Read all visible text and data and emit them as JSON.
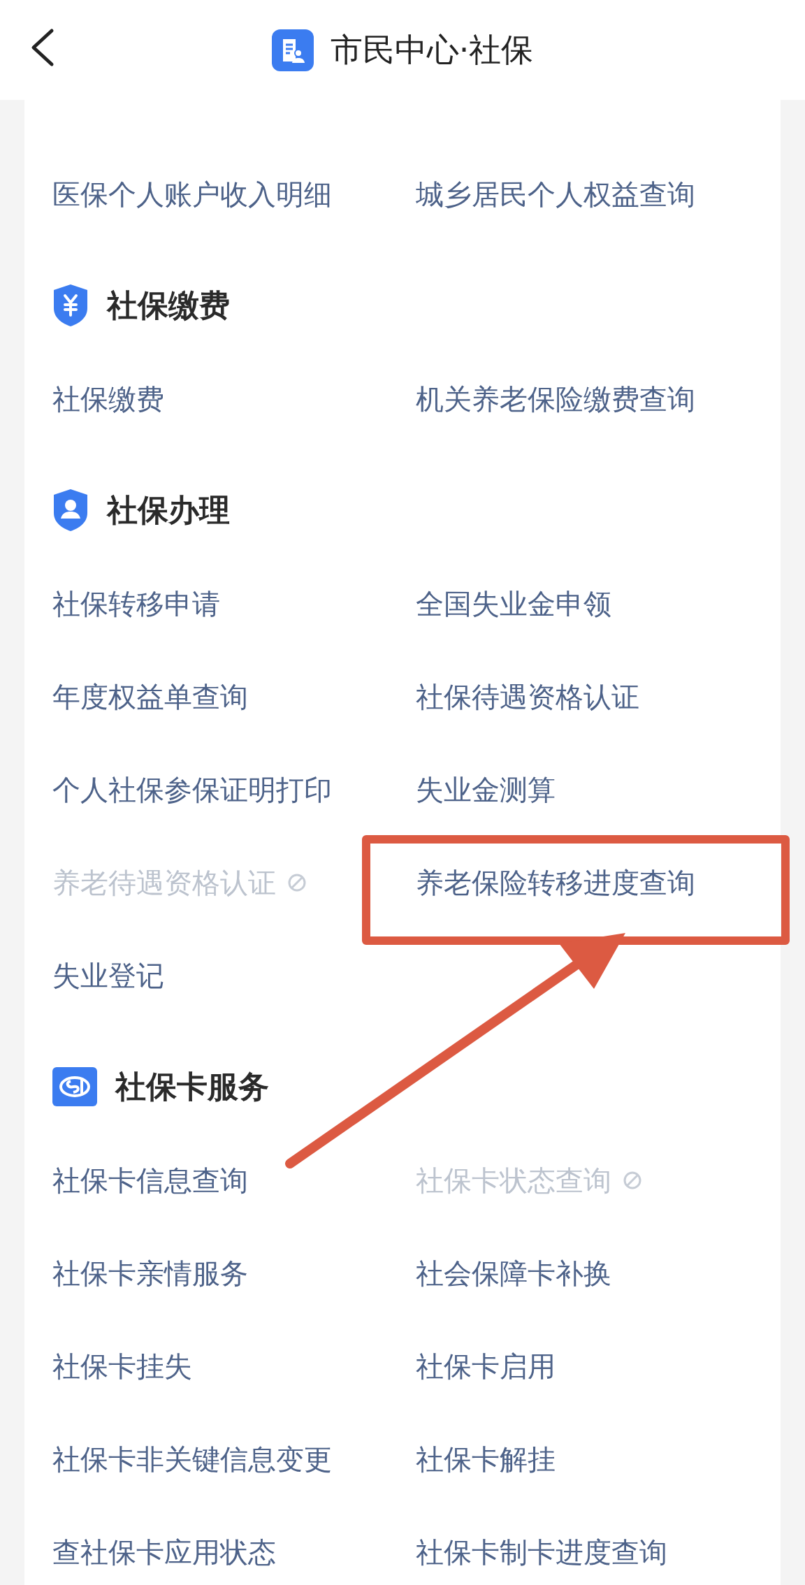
{
  "header": {
    "title": "市民中心·社保"
  },
  "sections": [
    {
      "items": [
        {
          "label": "医保个人账户收入明细",
          "disabled": false
        },
        {
          "label": "城乡居民个人权益查询",
          "disabled": false
        }
      ]
    },
    {
      "title": "社保缴费",
      "kind": "yuan-shield",
      "items": [
        {
          "label": "社保缴费",
          "disabled": false
        },
        {
          "label": "机关养老保险缴费查询",
          "disabled": false
        }
      ]
    },
    {
      "title": "社保办理",
      "kind": "person-shield",
      "items": [
        {
          "label": "社保转移申请",
          "disabled": false
        },
        {
          "label": "全国失业金申领",
          "disabled": false
        },
        {
          "label": "年度权益单查询",
          "disabled": false
        },
        {
          "label": "社保待遇资格认证",
          "disabled": false
        },
        {
          "label": "个人社保参保证明打印",
          "disabled": false
        },
        {
          "label": "失业金测算",
          "disabled": false
        },
        {
          "label": "养老待遇资格认证",
          "disabled": true
        },
        {
          "label": "养老保险转移进度查询",
          "disabled": false
        },
        {
          "label": "失业登记",
          "disabled": false
        }
      ]
    },
    {
      "title": "社保卡服务",
      "kind": "card",
      "items": [
        {
          "label": "社保卡信息查询",
          "disabled": false
        },
        {
          "label": "社保卡状态查询",
          "disabled": true
        },
        {
          "label": "社保卡亲情服务",
          "disabled": false
        },
        {
          "label": "社会保障卡补换",
          "disabled": false
        },
        {
          "label": "社保卡挂失",
          "disabled": false
        },
        {
          "label": "社保卡启用",
          "disabled": false
        },
        {
          "label": "社保卡非关键信息变更",
          "disabled": false
        },
        {
          "label": "社保卡解挂",
          "disabled": false
        },
        {
          "label": "查社保卡应用状态",
          "disabled": false
        },
        {
          "label": "社保卡制卡进度查询",
          "disabled": false
        }
      ]
    }
  ]
}
